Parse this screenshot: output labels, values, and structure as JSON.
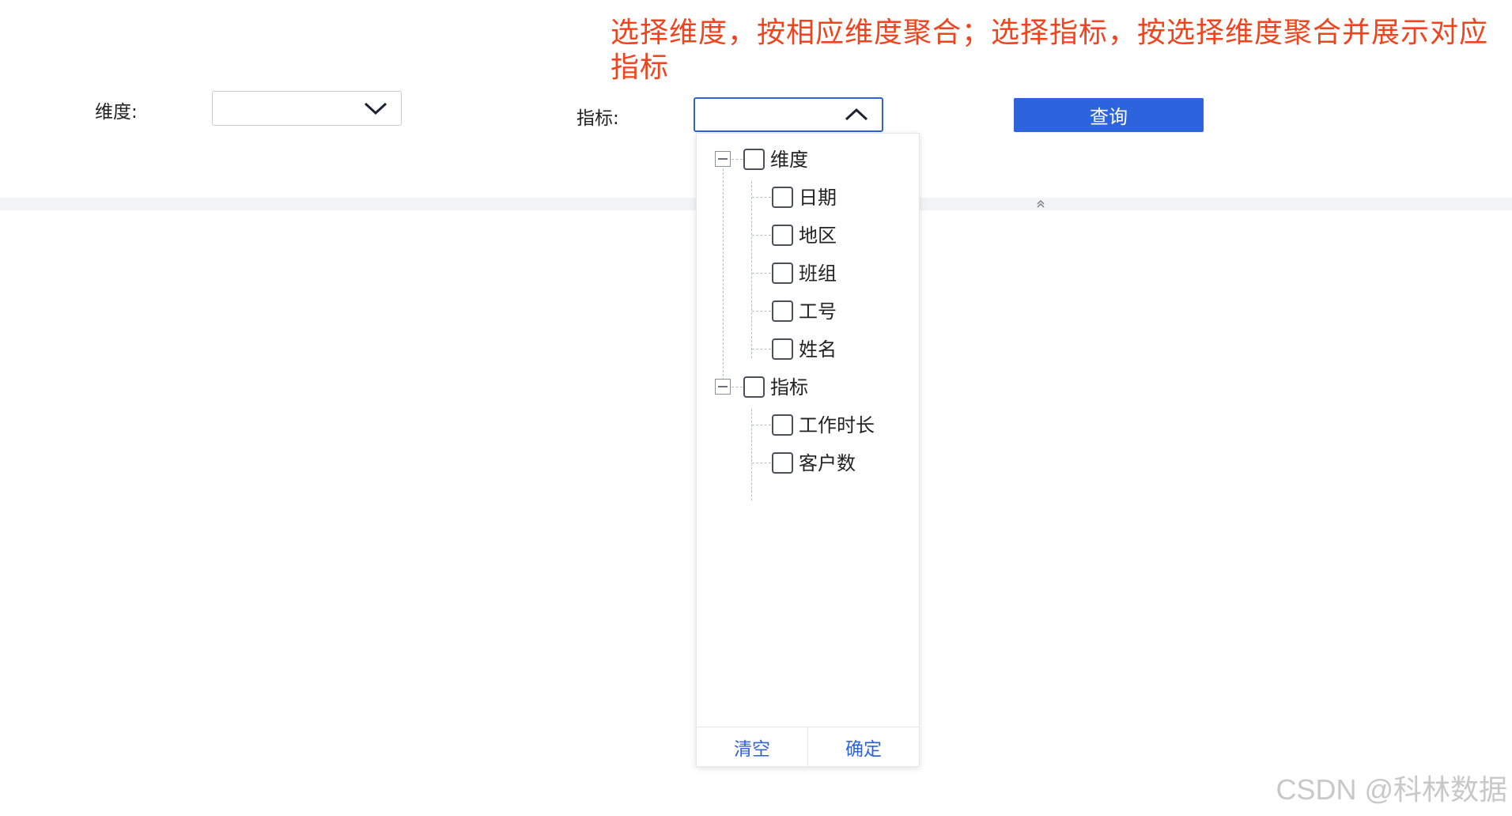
{
  "annotation": "选择维度，按相应维度聚合；选择指标，按选择维度聚合并展示对应指标",
  "filters": {
    "dimension_label": "维度:",
    "dimension_value": "",
    "metric_label": "指标:",
    "metric_value": "",
    "query_label": "查询"
  },
  "tree": {
    "groups": [
      {
        "label": "维度",
        "children": [
          "日期",
          "地区",
          "班组",
          "工号",
          "姓名"
        ]
      },
      {
        "label": "指标",
        "children": [
          "工作时长",
          "客户数"
        ]
      }
    ]
  },
  "dropdown_footer": {
    "clear_label": "清空",
    "confirm_label": "确定"
  },
  "watermark": "CSDN @科林数据",
  "colors": {
    "accent": "#2d63dd",
    "annotation": "#f0441e"
  }
}
